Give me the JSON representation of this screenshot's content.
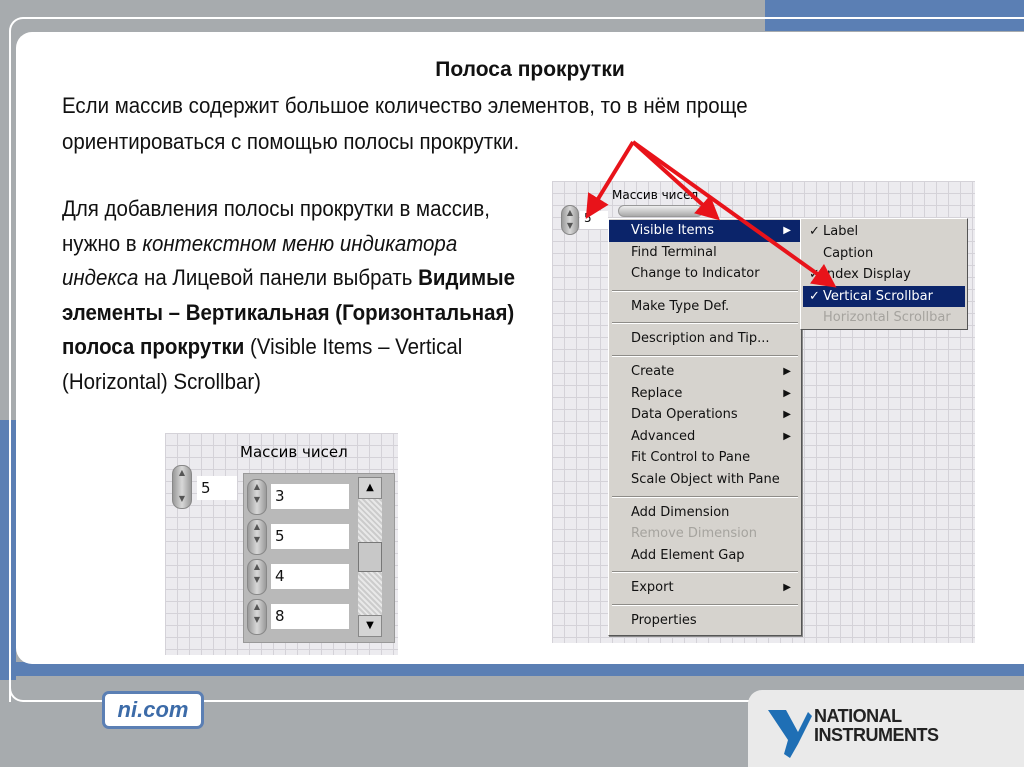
{
  "slide": {
    "title": "Полоса прокрутки",
    "intro_line1": "Если массив содержит большое количество элементов, то в нём проще",
    "intro_line2": "ориентироваться с помощью полосы прокрутки.",
    "body": {
      "t1": "Для добавления полосы прокрутки в массив, нужно в ",
      "t2": "контекстном меню индикатора индекса",
      "t3": " на Лицевой панели выбрать ",
      "t4": "Видимые элементы – Вертикальная (Горизонтальная) полоса прокрутки",
      "t5": " (Visible Items – Vertical (Horizontal) Scrollbar)"
    }
  },
  "context_screenshot": {
    "array_label": "Массив чисел",
    "index_value": "5",
    "menu": [
      {
        "label": "Visible Items",
        "submenu": true,
        "selected": true
      },
      {
        "label": "Find Terminal"
      },
      {
        "label": "Change to Indicator"
      },
      {
        "sep": true
      },
      {
        "label": "Make Type Def."
      },
      {
        "sep": true
      },
      {
        "label": "Description and Tip..."
      },
      {
        "sep": true
      },
      {
        "label": "Create",
        "submenu": true
      },
      {
        "label": "Replace",
        "submenu": true
      },
      {
        "label": "Data Operations",
        "submenu": true
      },
      {
        "label": "Advanced",
        "submenu": true
      },
      {
        "label": "Fit Control to Pane"
      },
      {
        "label": "Scale Object with Pane"
      },
      {
        "sep": true
      },
      {
        "label": "Add Dimension"
      },
      {
        "label": "Remove Dimension",
        "disabled": true
      },
      {
        "label": "Add Element Gap"
      },
      {
        "sep": true
      },
      {
        "label": "Export",
        "submenu": true
      },
      {
        "sep": true
      },
      {
        "label": "Properties"
      }
    ],
    "submenu": [
      {
        "label": "Label",
        "checked": true
      },
      {
        "label": "Caption",
        "checked": false
      },
      {
        "label": "Index Display",
        "checked": true
      },
      {
        "label": "Vertical Scrollbar",
        "checked": true,
        "selected": true
      },
      {
        "label": "Horizontal Scrollbar",
        "checked": false,
        "disabled": true
      }
    ]
  },
  "array_screenshot": {
    "label": "Массив чисел",
    "index_value": "5",
    "elements": [
      "3",
      "5",
      "4",
      "8"
    ],
    "scrollbar_position": 0.5
  },
  "footer": {
    "site": "ni.com",
    "logo_text": "NATIONAL INSTRUMENTS"
  },
  "colors": {
    "accent_blue": "#5b7fb4",
    "menu_highlight": "#0b246a",
    "arrow_red": "#e8131a"
  }
}
